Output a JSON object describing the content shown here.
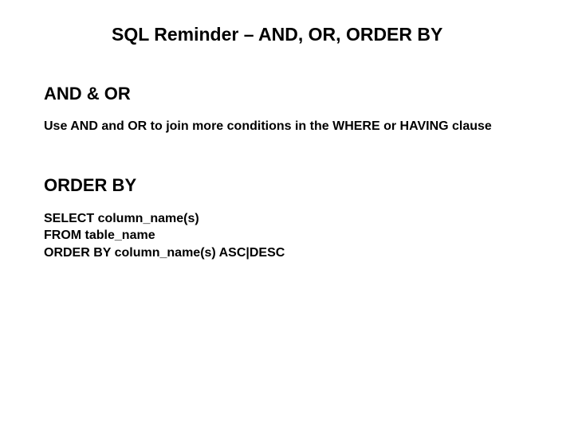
{
  "title": "SQL Reminder – AND, OR, ORDER BY",
  "section1": {
    "heading": "AND & OR",
    "body": "Use AND and OR to join more conditions in the WHERE or HAVING clause"
  },
  "section2": {
    "heading": "ORDER BY",
    "code": {
      "line1": "SELECT column_name(s)",
      "line2": "FROM table_name",
      "line3": "ORDER BY column_name(s) ASC|DESC"
    }
  }
}
